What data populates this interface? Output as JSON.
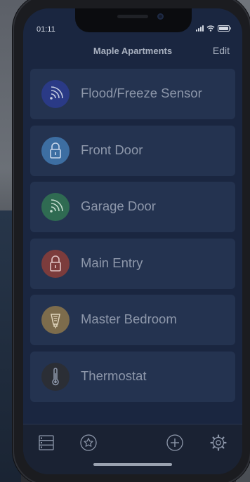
{
  "status_bar": {
    "time": "01:11"
  },
  "nav": {
    "title": "Maple Apartments",
    "edit_label": "Edit"
  },
  "devices": [
    {
      "label": "Flood/Freeze Sensor",
      "icon": "wireless-sensor-icon",
      "color": "#2a3a86"
    },
    {
      "label": "Front Door",
      "icon": "lock-icon",
      "color": "#3d6ea2"
    },
    {
      "label": "Garage Door",
      "icon": "wireless-sensor-icon",
      "color": "#2f6b52"
    },
    {
      "label": "Main Entry",
      "icon": "lock-icon",
      "color": "#7c3c3c"
    },
    {
      "label": "Master Bedroom",
      "icon": "bulb-icon",
      "color": "#7d6c4c"
    },
    {
      "label": "Thermostat",
      "icon": "thermometer-icon",
      "color": "#2b2e35"
    }
  ],
  "tab_bar": [
    {
      "name": "devices-list-icon"
    },
    {
      "name": "favorites-star-icon"
    },
    {
      "name": "add-icon"
    },
    {
      "name": "settings-gear-icon"
    }
  ]
}
